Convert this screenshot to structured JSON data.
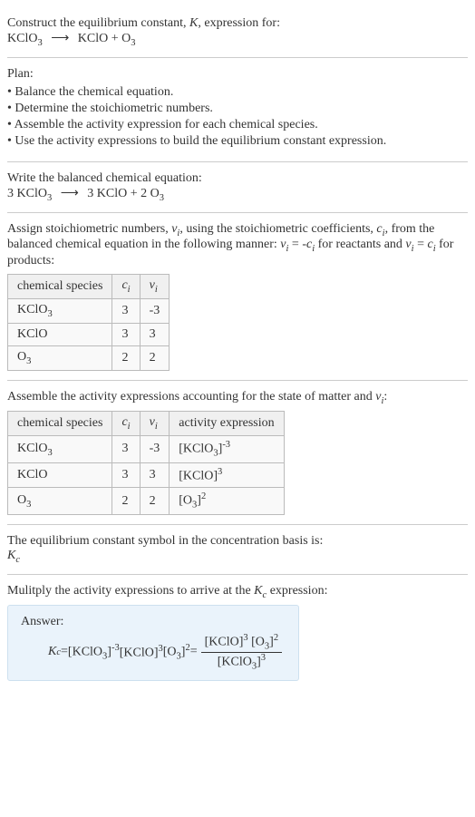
{
  "header": {
    "prompt": "Construct the equilibrium constant, ",
    "K": "K",
    "prompt2": ", expression for:",
    "reaction_lhs": "KClO",
    "reaction_lhs_sub": "3",
    "arrow": "⟶",
    "reaction_rhs1": "KClO + O",
    "reaction_rhs1_sub": "3"
  },
  "plan": {
    "title": "Plan:",
    "b1": "• Balance the chemical equation.",
    "b2": "• Determine the stoichiometric numbers.",
    "b3": "• Assemble the activity expression for each chemical species.",
    "b4": "• Use the activity expressions to build the equilibrium constant expression."
  },
  "balanced": {
    "title": "Write the balanced chemical equation:",
    "lhs_coef": "3",
    "lhs": "KClO",
    "lhs_sub": "3",
    "arrow": "⟶",
    "rhs1_coef": "3",
    "rhs1": "KClO + ",
    "rhs2_coef": "2",
    "rhs2": "O",
    "rhs2_sub": "3"
  },
  "stoich": {
    "intro1": "Assign stoichiometric numbers, ",
    "nu": "ν",
    "i": "i",
    "intro2": ", using the stoichiometric coefficients, ",
    "c": "c",
    "intro3": ", from the balanced chemical equation in the following manner: ",
    "rel1": " = -",
    "intro4": " for reactants and ",
    "rel2": " = ",
    "intro5": " for products:",
    "h1": "chemical species",
    "h2": "c",
    "h3": "ν",
    "r1c1": "KClO",
    "r1c1_sub": "3",
    "r1c2": "3",
    "r1c3": "-3",
    "r2c1": "KClO",
    "r2c2": "3",
    "r2c3": "3",
    "r3c1": "O",
    "r3c1_sub": "3",
    "r3c2": "2",
    "r3c3": "2"
  },
  "activity": {
    "title1": "Assemble the activity expressions accounting for the state of matter and ",
    "title2": ":",
    "h1": "chemical species",
    "h2": "c",
    "h3": "ν",
    "h4": "activity expression",
    "r1c1": "KClO",
    "r1c1_sub": "3",
    "r1c2": "3",
    "r1c3": "-3",
    "r1c4_base": "[KClO",
    "r1c4_sub": "3",
    "r1c4_close": "]",
    "r1c4_sup": "-3",
    "r2c1": "KClO",
    "r2c2": "3",
    "r2c3": "3",
    "r2c4": "[KClO]",
    "r2c4_sup": "3",
    "r3c1": "O",
    "r3c1_sub": "3",
    "r3c2": "2",
    "r3c3": "2",
    "r3c4_base": "[O",
    "r3c4_sub": "3",
    "r3c4_close": "]",
    "r3c4_sup": "2"
  },
  "basis": {
    "line1": "The equilibrium constant symbol in the concentration basis is:",
    "Kc": "K",
    "c": "c"
  },
  "multiply": {
    "line": "Mulitply the activity expressions to arrive at the ",
    "Kc": "K",
    "c": "c",
    "line2": " expression:"
  },
  "answer": {
    "label": "Answer:",
    "Kc": "K",
    "c": "c",
    "eq": " = ",
    "t1": "[KClO",
    "t1sub": "3",
    "t1close": "]",
    "t1sup": "-3",
    "t2": " [KClO]",
    "t2sup": "3",
    "t3": " [O",
    "t3sub": "3",
    "t3close": "]",
    "t3sup": "2",
    "eq2": " = ",
    "num1": "[KClO]",
    "num1sup": "3",
    "num2": " [O",
    "num2sub": "3",
    "num2close": "]",
    "num2sup": "2",
    "den1": "[KClO",
    "den1sub": "3",
    "den1close": "]",
    "den1sup": "3"
  }
}
